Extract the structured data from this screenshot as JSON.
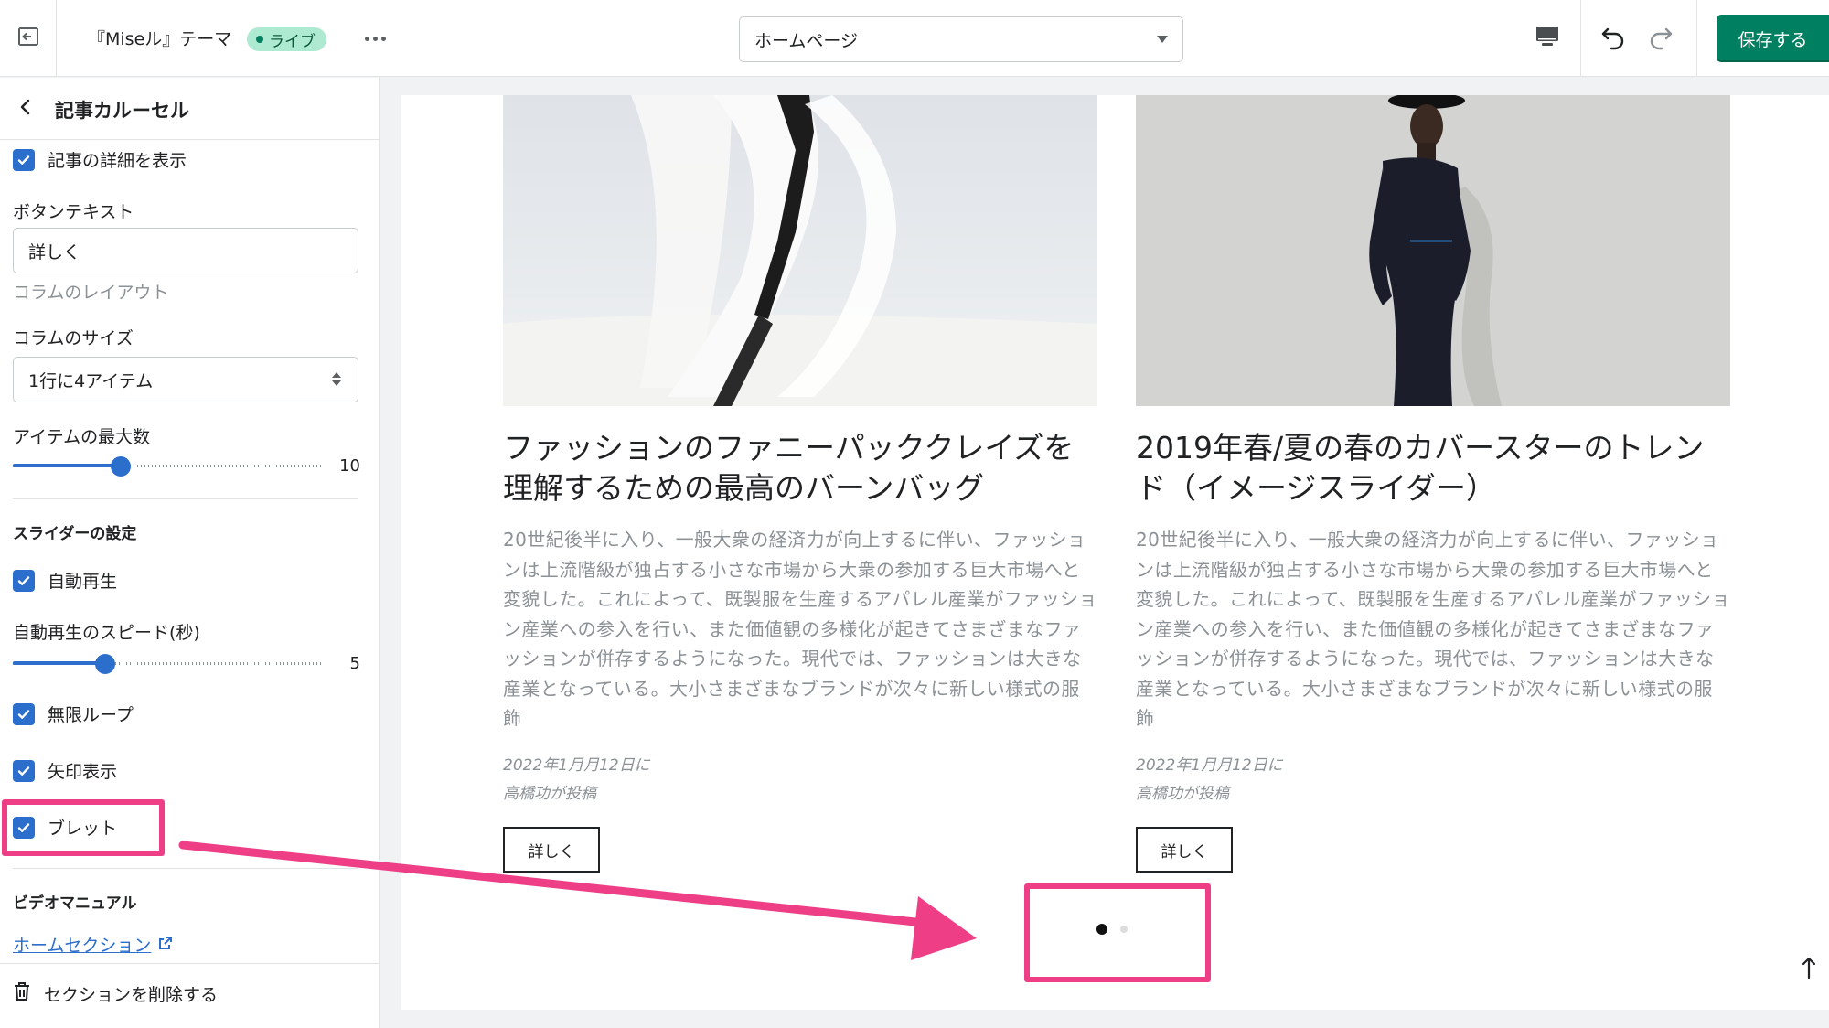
{
  "topbar": {
    "theme_name": "『Miseル』テーマ",
    "live_badge": "ライブ",
    "page_select": "ホームページ",
    "save_label": "保存する",
    "icons": [
      "exit-icon",
      "more-icon",
      "desktop-icon",
      "undo-icon",
      "redo-icon"
    ]
  },
  "sidebar": {
    "title": "記事カルーセル",
    "show_details": "記事の詳細を表示",
    "button_text_label": "ボタンテキスト",
    "button_text_value": "詳しく",
    "column_layout_label": "コラムのレイアウト",
    "column_size_label": "コラムのサイズ",
    "column_size_value": "1行に4アイテム",
    "max_items_label": "アイテムの最大数",
    "max_items_value": "10",
    "max_items_fraction": 0.35,
    "slider_section_title": "スライダーの設定",
    "autoplay_label": "自動再生",
    "autoplay_speed_label": "自動再生のスピード(秒)",
    "autoplay_speed_value": "5",
    "autoplay_speed_fraction": 0.3,
    "infinite_loop_label": "無限ループ",
    "arrows_label": "矢印表示",
    "bullets_label": "ブレット",
    "video_manual_title": "ビデオマニュアル",
    "home_section_link": "ホームセクション",
    "delete_section": "セクションを削除する"
  },
  "preview": {
    "cards": [
      {
        "title": "ファッションのファニーパッククレイズを理解するための最高のバーンバッグ",
        "excerpt": "20世紀後半に入り、一般大衆の経済力が向上するに伴い、ファッションは上流階級が独占する小さな市場から大衆の参加する巨大市場へと変貌した。これによって、既製服を生産するアパレル産業がファッション産業への参入を行い、また価値観の多様化が起きてさまざまなファッションが併存するようになった。現代では、ファッションは大きな産業となっている。大小さまざまなブランドが次々に新しい様式の服飾",
        "date": "2022年1月月12日に",
        "author": "高橋功が投稿",
        "button": "詳しく"
      },
      {
        "title": "2019年春/夏の春のカバースターのトレンド（イメージスライダー）",
        "excerpt": "20世紀後半に入り、一般大衆の経済力が向上するに伴い、ファッションは上流階級が独占する小さな市場から大衆の参加する巨大市場へと変貌した。これによって、既製服を生産するアパレル産業がファッション産業への参入を行い、また価値観の多様化が起きてさまざまなファッションが併存するようになった。現代では、ファッションは大きな産業となっている。大小さまざまなブランドが次々に新しい様式の服飾",
        "date": "2022年1月月12日に",
        "author": "高橋功が投稿",
        "button": "詳しく"
      }
    ],
    "pagination": {
      "current": 1,
      "total": 2
    }
  },
  "colors": {
    "accent": "#2c6ecb",
    "save_green": "#008060",
    "annotation_pink": "#ed3e86",
    "live_badge_bg": "#aee9d1"
  }
}
